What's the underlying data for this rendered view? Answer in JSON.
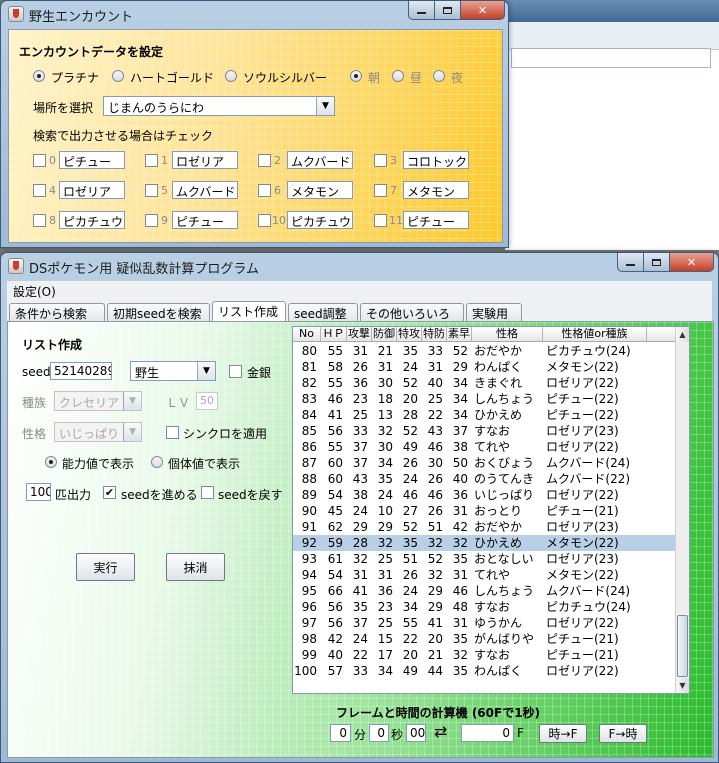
{
  "encounter_window": {
    "title": "野生エンカウント",
    "heading": "エンカウントデータを設定",
    "versions": [
      {
        "label": "プラチナ",
        "selected": true
      },
      {
        "label": "ハートゴールド",
        "selected": false
      },
      {
        "label": "ソウルシルバー",
        "selected": false
      }
    ],
    "times": [
      {
        "label": "朝",
        "selected": true
      },
      {
        "label": "昼",
        "selected": false
      },
      {
        "label": "夜",
        "selected": false
      }
    ],
    "location_label": "場所を選択",
    "location_value": "じまんのうらにわ",
    "check_label": "検索で出力させる場合はチェック",
    "slots": [
      {
        "index": "0",
        "pokemon": "ピチュー"
      },
      {
        "index": "1",
        "pokemon": "ロゼリア"
      },
      {
        "index": "2",
        "pokemon": "ムクバード"
      },
      {
        "index": "3",
        "pokemon": "コロトック"
      },
      {
        "index": "4",
        "pokemon": "ロゼリア"
      },
      {
        "index": "5",
        "pokemon": "ムクバード"
      },
      {
        "index": "6",
        "pokemon": "メタモン"
      },
      {
        "index": "7",
        "pokemon": "メタモン"
      },
      {
        "index": "8",
        "pokemon": "ピカチュウ"
      },
      {
        "index": "9",
        "pokemon": "ピチュー"
      },
      {
        "index": "10",
        "pokemon": "ピカチュウ"
      },
      {
        "index": "11",
        "pokemon": "ピチュー"
      }
    ]
  },
  "main_window": {
    "title": "DSポケモン用 疑似乱数計算プログラム",
    "menu": {
      "settings": "設定(O)"
    },
    "tabs": [
      "条件から検索",
      "初期seedを検索",
      "リスト作成",
      "seed調整",
      "その他いろいろ",
      "実験用"
    ],
    "active_tab": "リスト作成",
    "panel": {
      "heading": "リスト作成",
      "seed_label": "seed",
      "seed_value": "52140289",
      "mode_value": "野生",
      "gold_label": "金銀",
      "species_label": "種族",
      "species_value": "クレセリア",
      "level_label": "ＬＶ",
      "level_value": "50",
      "nature_label": "性格",
      "nature_value": "いじっぱり",
      "sync_label": "シンクロを適用",
      "display_stats_label": "能力値で表示",
      "display_iv_label": "個体値で表示",
      "count_value": "100",
      "count_label": "匹出力",
      "advance_label": "seedを進める",
      "advance_checked": true,
      "rewind_label": "seedを戻す",
      "run_button": "実行",
      "clear_button": "抹消"
    },
    "table": {
      "headers": [
        "No",
        "ＨＰ",
        "攻撃",
        "防御",
        "特攻",
        "特防",
        "素早",
        "性格",
        "性格値or種族"
      ],
      "selected_no": "92",
      "rows": [
        [
          "80",
          "55",
          "31",
          "21",
          "35",
          "33",
          "52",
          "おだやか",
          "ピカチュウ(24)"
        ],
        [
          "81",
          "58",
          "26",
          "31",
          "24",
          "31",
          "29",
          "わんぱく",
          "メタモン(22)"
        ],
        [
          "82",
          "55",
          "36",
          "30",
          "52",
          "40",
          "34",
          "きまぐれ",
          "ロゼリア(22)"
        ],
        [
          "83",
          "46",
          "23",
          "18",
          "20",
          "25",
          "34",
          "しんちょう",
          "ピチュー(22)"
        ],
        [
          "84",
          "41",
          "25",
          "13",
          "28",
          "22",
          "34",
          "ひかえめ",
          "ピチュー(22)"
        ],
        [
          "85",
          "56",
          "33",
          "32",
          "52",
          "43",
          "37",
          "すなお",
          "ロゼリア(23)"
        ],
        [
          "86",
          "55",
          "37",
          "30",
          "49",
          "46",
          "38",
          "てれや",
          "ロゼリア(22)"
        ],
        [
          "87",
          "60",
          "37",
          "34",
          "26",
          "30",
          "50",
          "おくびょう",
          "ムクバード(24)"
        ],
        [
          "88",
          "60",
          "43",
          "35",
          "24",
          "26",
          "40",
          "のうてんき",
          "ムクバード(22)"
        ],
        [
          "89",
          "54",
          "38",
          "24",
          "46",
          "46",
          "36",
          "いじっぱり",
          "ロゼリア(22)"
        ],
        [
          "90",
          "45",
          "24",
          "10",
          "27",
          "26",
          "31",
          "おっとり",
          "ピチュー(21)"
        ],
        [
          "91",
          "62",
          "29",
          "29",
          "52",
          "51",
          "42",
          "おだやか",
          "ロゼリア(23)"
        ],
        [
          "92",
          "59",
          "28",
          "32",
          "35",
          "32",
          "32",
          "ひかえめ",
          "メタモン(22)"
        ],
        [
          "93",
          "61",
          "32",
          "25",
          "51",
          "52",
          "35",
          "おとなしい",
          "ロゼリア(23)"
        ],
        [
          "94",
          "54",
          "31",
          "31",
          "26",
          "32",
          "31",
          "てれや",
          "メタモン(22)"
        ],
        [
          "95",
          "66",
          "41",
          "36",
          "24",
          "29",
          "46",
          "しんちょう",
          "ムクバード(24)"
        ],
        [
          "96",
          "56",
          "35",
          "23",
          "34",
          "29",
          "48",
          "すなお",
          "ピカチュウ(24)"
        ],
        [
          "97",
          "56",
          "37",
          "25",
          "55",
          "41",
          "31",
          "ゆうかん",
          "ロゼリア(22)"
        ],
        [
          "98",
          "42",
          "24",
          "15",
          "22",
          "20",
          "35",
          "がんばりや",
          "ピチュー(21)"
        ],
        [
          "99",
          "40",
          "22",
          "17",
          "20",
          "21",
          "32",
          "すなお",
          "ピチュー(21)"
        ],
        [
          "100",
          "57",
          "33",
          "34",
          "49",
          "44",
          "35",
          "わんぱく",
          "ロゼリア(22)"
        ]
      ]
    },
    "calculator": {
      "title": "フレームと時間の計算機 (60Fで1秒)",
      "min_value": "0",
      "min_unit": "分",
      "sec_value": "0",
      "sec_unit": "秒",
      "sub_value": "00",
      "frame_value": "0",
      "frame_unit": "F",
      "time_to_frame": "時→F",
      "frame_to_time": "F→時"
    }
  }
}
